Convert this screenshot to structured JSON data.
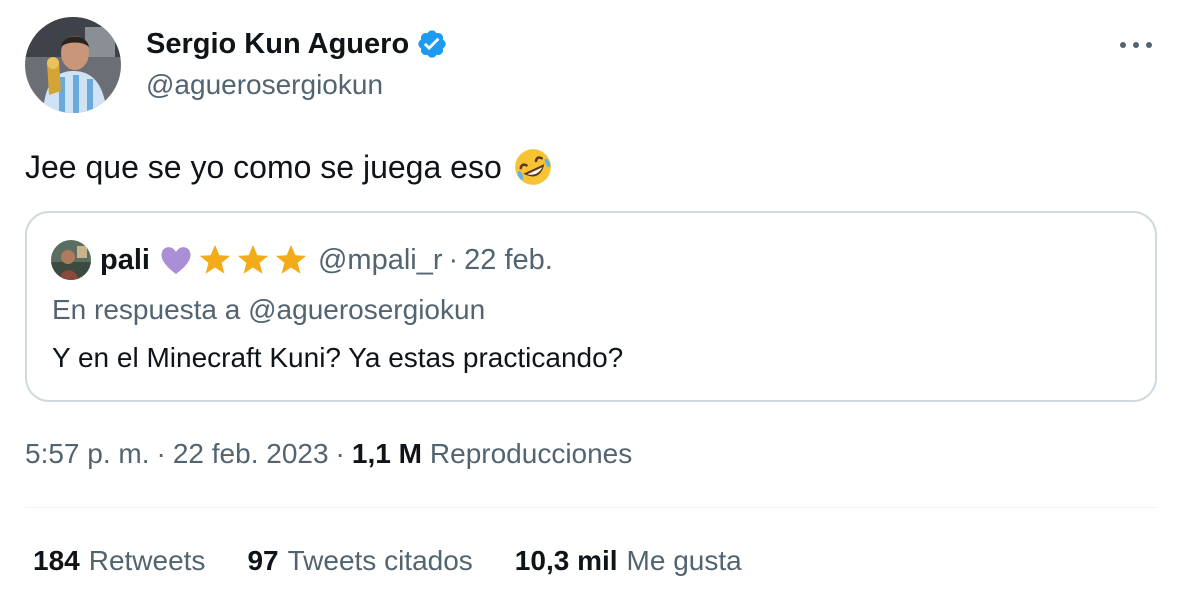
{
  "author": {
    "name": "Sergio Kun Aguero",
    "handle": "@aguerosergiokun",
    "verified_icon": "verified-badge-icon",
    "verified_color": "#1d9bf0"
  },
  "tweet": {
    "text": "Jee que se yo como se juega eso",
    "emoji": "rolling-on-the-floor-laughing-icon"
  },
  "quote": {
    "name": "pali",
    "badges": [
      "purple-heart-icon",
      "star-icon",
      "star-icon",
      "star-icon"
    ],
    "handle": "@mpali_r",
    "separator": "·",
    "date": "22 feb.",
    "reply_to": "En respuesta a @aguerosergiokun",
    "text": "Y en el Minecraft Kuni? Ya estas practicando?"
  },
  "meta": {
    "time": "5:57 p. m.",
    "separator": "·",
    "date": "22 feb. 2023",
    "separator2": "·",
    "views_count": "1,1 M",
    "views_label": "Reproducciones"
  },
  "stats": [
    {
      "count": "184",
      "label": "Retweets"
    },
    {
      "count": "97",
      "label": "Tweets citados"
    },
    {
      "count": "10,3 mil",
      "label": "Me gusta"
    }
  ],
  "colors": {
    "text_primary": "#0f1419",
    "text_secondary": "#536471",
    "border": "#cfd9de"
  }
}
